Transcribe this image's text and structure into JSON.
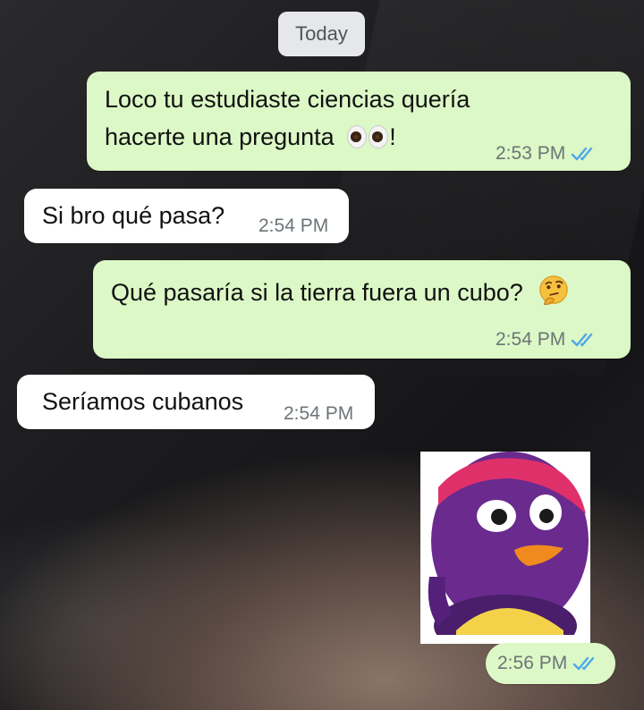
{
  "date_chip": "Today",
  "messages": [
    {
      "direction": "outgoing",
      "line1": "Loco tu estudiaste ciencias quería",
      "line2": "hacerte una pregunta",
      "emoji": "eyes-emoji",
      "suffix": "!",
      "time": "2:53 PM",
      "status": "read"
    },
    {
      "direction": "incoming",
      "text": "Si bro qué pasa?",
      "time": "2:54 PM"
    },
    {
      "direction": "outgoing",
      "text": "Qué pasaría si la tierra fuera un cubo?",
      "emoji": "thinking-face-emoji",
      "time": "2:54 PM",
      "status": "read"
    },
    {
      "direction": "incoming",
      "text": "Seríamos cubanos",
      "time": "2:54 PM"
    },
    {
      "direction": "outgoing",
      "type": "sticker",
      "sticker": "purple-penguin-sticker",
      "time": "2:56 PM",
      "status": "read"
    }
  ],
  "colors": {
    "outgoing_bubble": "#dcf8c6",
    "incoming_bubble": "#ffffff",
    "read_tick": "#4fa8e8",
    "timestamp": "#6c7478"
  }
}
